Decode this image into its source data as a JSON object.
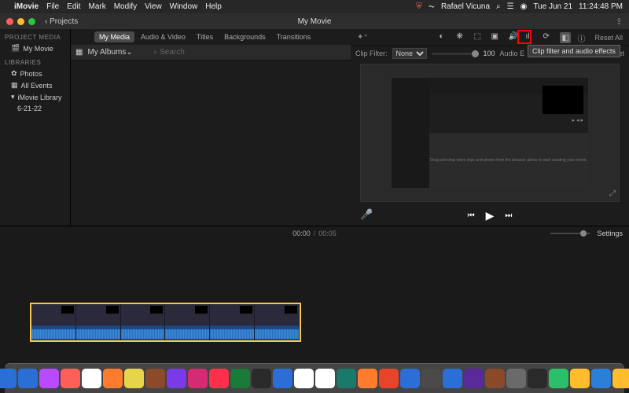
{
  "menubar": {
    "app": "iMovie",
    "items": [
      "File",
      "Edit",
      "Mark",
      "Modify",
      "View",
      "Window",
      "Help"
    ],
    "user": "Rafael Vicuna",
    "date": "Tue Jun 21",
    "time": "11:24:48 PM"
  },
  "window": {
    "title": "My Movie",
    "projects_btn": "‹ Projects"
  },
  "tabs": {
    "items": [
      "My Media",
      "Audio & Video",
      "Titles",
      "Backgrounds",
      "Transitions"
    ],
    "active": 0
  },
  "browser": {
    "albums_label": "My Albums",
    "search_placeholder": "Search"
  },
  "sidebar": {
    "section1": "PROJECT MEDIA",
    "item1": "My Movie",
    "section2": "LIBRARIES",
    "item2": "Photos",
    "item3": "All Events",
    "item4": "iMovie Library",
    "item5": "6-21-22"
  },
  "inspector": {
    "reset_all": "Reset All",
    "tooltip": "Clip filter and audio effects",
    "clip_filter_label": "Clip Filter:",
    "clip_filter_value": "None",
    "slider_value": "100",
    "audio_label": "Audio E",
    "reset": "Reset"
  },
  "preview": {
    "hint": "Drag and drop video clips and photos from the browser above to start creating your movie."
  },
  "timecode": {
    "current": "00:00",
    "duration": "00:05",
    "settings": "Settings"
  },
  "dock_colors": [
    "#2b6fd6",
    "#2b6fd6",
    "#b84aff",
    "#ff5f56",
    "#fff",
    "#ff7b2e",
    "#e8d44a",
    "#8b4a2a",
    "#7a3ae8",
    "#d62b72",
    "#ff2e4a",
    "#1a7a3a",
    "#2a2a2a",
    "#2b6fd6",
    "#fff",
    "#fff",
    "#1a7a6a",
    "#ff7b2e",
    "#e8442a",
    "#2b6fd6",
    "#4a4a4a",
    "#2b6fd6",
    "#5a2a9a",
    "#8a4a2a",
    "#6a6a6a",
    "#2a2a2a",
    "#2bbf6a",
    "#ffbd2e",
    "#2b7fd6",
    "#ffbd2e"
  ]
}
